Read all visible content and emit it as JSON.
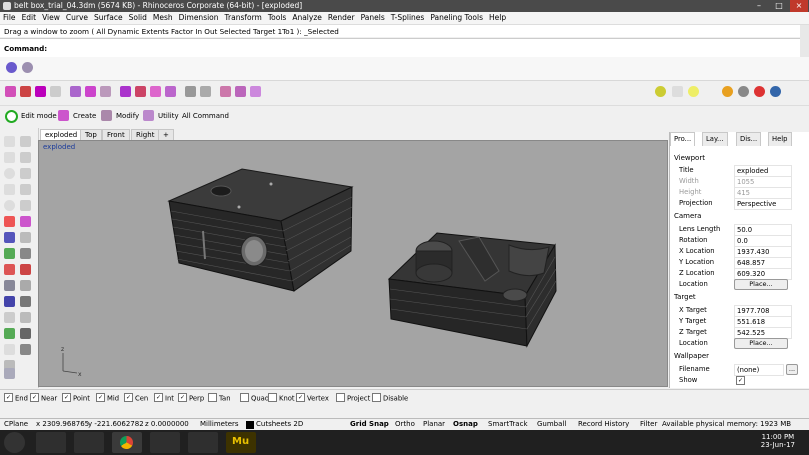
{
  "window": {
    "title": "belt box_trial_04.3dm (5674 KB) - Rhinoceros Corporate (64-bit) - [exploded]",
    "minimize": "–",
    "maximize": "□",
    "close": "×"
  },
  "menu": [
    "File",
    "Edit",
    "View",
    "Curve",
    "Surface",
    "Solid",
    "Mesh",
    "Dimension",
    "Transform",
    "Tools",
    "Analyze",
    "Render",
    "Panels",
    "T-Splines",
    "Paneling Tools",
    "Help"
  ],
  "command_history": "Drag a window to zoom ( All  Dynamic  Extents  Factor  In  Out  Selected  Target  1To1 ): _Selected",
  "command_prompt": "Command:",
  "toolbar3": {
    "edit_mode": "Edit mode",
    "create": "Create",
    "modify": "Modify",
    "utility": "Utility",
    "all_command": "All Command"
  },
  "viewport_tabs": [
    "exploded",
    "Top",
    "Front",
    "Right",
    "+"
  ],
  "viewport": {
    "label": "exploded",
    "axis_z": "z",
    "axis_x": "x"
  },
  "panel_tabs": [
    "Pro...",
    "Lay...",
    "Dis...",
    "Help"
  ],
  "properties": {
    "viewport_header": "Viewport",
    "title_label": "Title",
    "title_value": "exploded",
    "width_label": "Width",
    "width_value": "1055",
    "height_label": "Height",
    "height_value": "415",
    "projection_label": "Projection",
    "projection_value": "Perspective",
    "camera_header": "Camera",
    "lens_label": "Lens Length",
    "lens_value": "50.0",
    "rotation_label": "Rotation",
    "rotation_value": "0.0",
    "xloc_label": "X Location",
    "xloc_value": "1937.430",
    "yloc_label": "Y Location",
    "yloc_value": "648.857",
    "zloc_label": "Z Location",
    "zloc_value": "609.320",
    "location_label": "Location",
    "place_button": "Place...",
    "target_header": "Target",
    "xtarget_label": "X Target",
    "xtarget_value": "1977.708",
    "ytarget_label": "Y Target",
    "ytarget_value": "551.618",
    "ztarget_label": "Z Target",
    "ztarget_value": "542.525",
    "tlocation_label": "Location",
    "tplace_button": "Place...",
    "wallpaper_header": "Wallpaper",
    "filename_label": "Filename",
    "filename_value": "(none)",
    "filename_btn": "...",
    "show_label": "Show",
    "show_checked": "✓"
  },
  "osnaps": [
    {
      "label": "End",
      "checked": true
    },
    {
      "label": "Near",
      "checked": true
    },
    {
      "label": "Point",
      "checked": true
    },
    {
      "label": "Mid",
      "checked": true
    },
    {
      "label": "Cen",
      "checked": true
    },
    {
      "label": "Int",
      "checked": true
    },
    {
      "label": "Perp",
      "checked": true
    },
    {
      "label": "Tan",
      "checked": false
    },
    {
      "label": "Quad",
      "checked": false
    },
    {
      "label": "Knot",
      "checked": false
    },
    {
      "label": "Vertex",
      "checked": true
    },
    {
      "label": "Project",
      "checked": false
    },
    {
      "label": "Disable",
      "checked": false
    }
  ],
  "status": {
    "cplane": "CPlane",
    "x": "x 2309.968765",
    "y": "y -221.6062782",
    "z": "z 0.0000000",
    "units": "Millimeters",
    "layer": "Cutsheets 2D",
    "grid_snap": "Grid Snap",
    "ortho": "Ortho",
    "planar": "Planar",
    "osnap": "Osnap",
    "smarttrack": "SmartTrack",
    "gumball": "Gumball",
    "record_history": "Record History",
    "filter": "Filter",
    "memory": "Available physical memory: 1923 MB"
  },
  "taskbar": {
    "time": "11:00 PM",
    "date": "23-Jun-17",
    "mu_label": "Mu"
  },
  "colors": {
    "viewport_bg": "#a4a4a4",
    "accent": "#1b3b9a",
    "taskbar": "#202020"
  }
}
